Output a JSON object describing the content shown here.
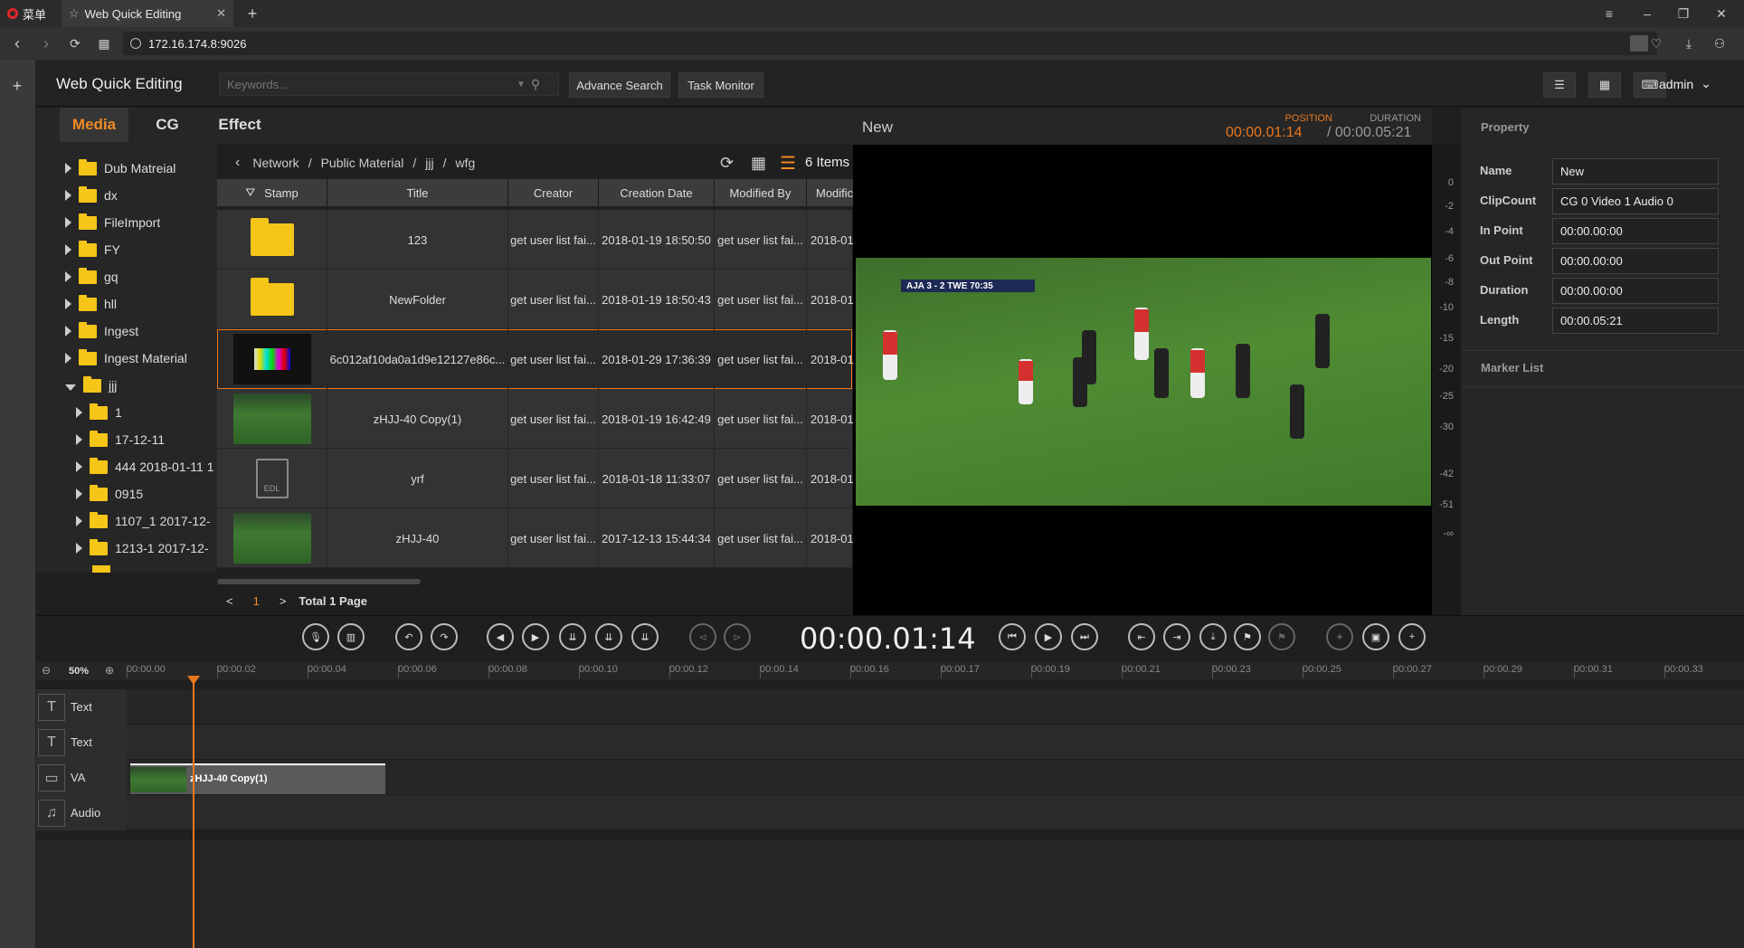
{
  "browser": {
    "menu_label": "菜单",
    "tab_title": "Web Quick Editing",
    "url": "172.16.174.8:9026"
  },
  "header": {
    "app_title": "Web Quick Editing",
    "search_placeholder": "Keywords...",
    "advance_search": "Advance Search",
    "task_monitor": "Task Monitor",
    "user": "admin"
  },
  "media_tabs": [
    "Media",
    "CG",
    "Effect"
  ],
  "tree": [
    {
      "label": "Dub Matreial",
      "expanded": false
    },
    {
      "label": "dx",
      "expanded": false
    },
    {
      "label": "FileImport",
      "expanded": false
    },
    {
      "label": "FY",
      "expanded": false
    },
    {
      "label": "gq",
      "expanded": false
    },
    {
      "label": "hll",
      "expanded": false
    },
    {
      "label": "Ingest",
      "expanded": false
    },
    {
      "label": "Ingest Material",
      "expanded": false
    },
    {
      "label": "jjj",
      "expanded": true
    },
    {
      "label": "1",
      "expanded": false
    },
    {
      "label": "17-12-11",
      "expanded": false
    },
    {
      "label": "444 2018-01-11 1",
      "expanded": false
    },
    {
      "label": "0915",
      "expanded": false
    },
    {
      "label": "1107_1 2017-12-",
      "expanded": false
    },
    {
      "label": "1213-1 2017-12-",
      "expanded": false
    }
  ],
  "breadcrumb": [
    "Network",
    "Public Material",
    "jjj",
    "wfg"
  ],
  "breadcrumb_sep": "/",
  "item_count": "6 Items",
  "columns": [
    "Stamp",
    "Title",
    "Creator",
    "Creation Date",
    "Modified By",
    "Modific"
  ],
  "rows": [
    {
      "stamp": "folder",
      "title": "123",
      "creator": "get user list fai...",
      "created": "2018-01-19 18:50:50",
      "modified_by": "get user list fai...",
      "modified": "2018-01"
    },
    {
      "stamp": "folder",
      "title": "NewFolder",
      "creator": "get user list fai...",
      "created": "2018-01-19 18:50:43",
      "modified_by": "get user list fai...",
      "modified": "2018-01"
    },
    {
      "stamp": "colorbars",
      "title": "6c012af10da0a1d9e12127e86c...",
      "creator": "get user list fai...",
      "created": "2018-01-29 17:36:39",
      "modified_by": "get user list fai...",
      "modified": "2018-01"
    },
    {
      "stamp": "video",
      "title": "zHJJ-40 Copy(1)",
      "creator": "get user list fai...",
      "created": "2018-01-19 16:42:49",
      "modified_by": "get user list fai...",
      "modified": "2018-01"
    },
    {
      "stamp": "edl",
      "title": "yrf",
      "creator": "get user list fai...",
      "created": "2018-01-18 11:33:07",
      "modified_by": "get user list fai...",
      "modified": "2018-01"
    },
    {
      "stamp": "video",
      "title": "zHJJ-40",
      "creator": "get user list fai...",
      "created": "2017-12-13 15:44:34",
      "modified_by": "get user list fai...",
      "modified": "2018-01"
    }
  ],
  "edl_label": "EDL",
  "pager": {
    "prev": "<",
    "page": "1",
    "next": ">",
    "total": "Total 1 Page"
  },
  "preview": {
    "title": "New",
    "position_label": "POSITION",
    "position": "00:00.01:14",
    "duration_label": "DURATION",
    "duration": "/ 00:00.05:21",
    "scoreboard": "AJA 3 - 2 TWE 70:35"
  },
  "meter_labels": [
    "0",
    "-2",
    "-4",
    "-6",
    "-8",
    "-10",
    "-15",
    "-20",
    "-25",
    "-30",
    "-42",
    "-51",
    "-∞"
  ],
  "property": {
    "title": "Property",
    "fields": [
      {
        "label": "Name",
        "value": "New"
      },
      {
        "label": "ClipCount",
        "value": "CG 0 Video 1 Audio 0"
      },
      {
        "label": "In Point",
        "value": "00:00.00:00"
      },
      {
        "label": "Out Point",
        "value": "00:00.00:00"
      },
      {
        "label": "Duration",
        "value": "00:00.00:00"
      },
      {
        "label": "Length",
        "value": "00:00.05:21"
      }
    ],
    "marker_list": "Marker List"
  },
  "timecode": "00:00.01:14",
  "timeline": {
    "zoom": "50%",
    "ticks": [
      "00:00.00",
      "00:00.02",
      "00:00.04",
      "00:00.06",
      "00:00.08",
      "00:00.10",
      "00:00.12",
      "00:00.14",
      "00:00.16",
      "00:00.17",
      "00:00.19",
      "00:00.21",
      "00:00.23",
      "00:00.25",
      "00:00.27",
      "00:00.29",
      "00:00.31",
      "00:00.33"
    ],
    "tracks": [
      {
        "label": "Text",
        "icon": "text-icon"
      },
      {
        "label": "Text",
        "icon": "text-icon"
      },
      {
        "label": "VA",
        "icon": "video-camera-icon"
      },
      {
        "label": "Audio",
        "icon": "music-note-icon"
      }
    ],
    "clip_label": "zHJJ-40 Copy(1)"
  },
  "colors": {
    "accent": "#e8781e",
    "folder": "#f5c518",
    "background": "#1f1f1f"
  }
}
